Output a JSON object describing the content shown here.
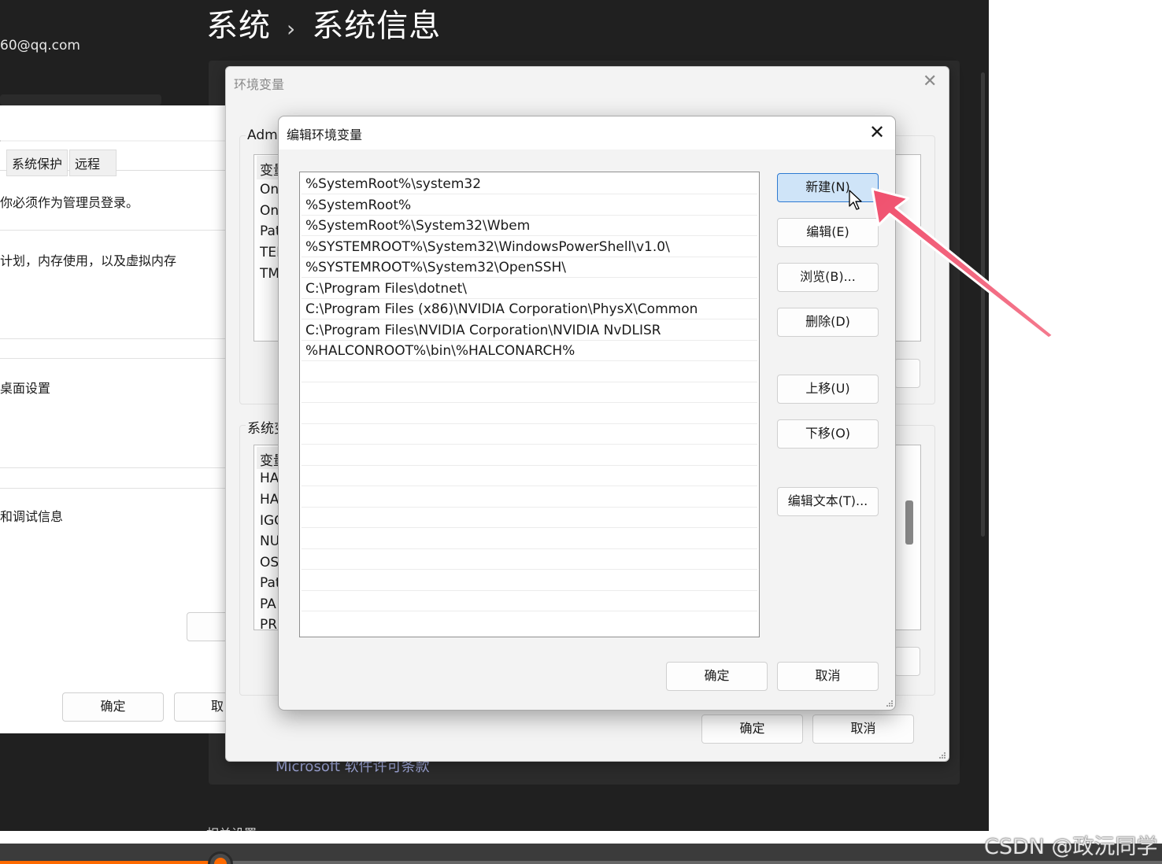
{
  "settings": {
    "breadcrumb_root": "系统",
    "breadcrumb_sep": "›",
    "breadcrumb_current": "系统信息",
    "account_email": "60@qq.com",
    "license_link": "Microsoft 软件许可条款",
    "related_settings": "相关设置"
  },
  "system_properties": {
    "tabs": [
      "系统保护",
      "远程"
    ],
    "admin_notice": "你必须作为管理员登录。",
    "performance_text": "计划，内存使用，以及虚拟内存",
    "profiles_text": "桌面设置",
    "startup_text": "和调试信息",
    "ok_label": "确定",
    "cancel_label": "取"
  },
  "env_vars": {
    "title": "环境变量",
    "user_group_label": "Adm",
    "user_list_header": "变量",
    "user_vars": [
      "On",
      "On",
      "Pat",
      "TEI",
      "TM"
    ],
    "system_group_label": "系统变",
    "system_list_header": "变量",
    "system_vars": [
      "HA",
      "HA",
      "IGC",
      "NU",
      "OS",
      "Pat",
      "PA",
      "PR"
    ],
    "ok_label": "确定",
    "cancel_label": "取消"
  },
  "edit_dialog": {
    "title": "编辑环境变量",
    "paths": [
      "%SystemRoot%\\system32",
      "%SystemRoot%",
      "%SystemRoot%\\System32\\Wbem",
      "%SYSTEMROOT%\\System32\\WindowsPowerShell\\v1.0\\",
      "%SYSTEMROOT%\\System32\\OpenSSH\\",
      "C:\\Program Files\\dotnet\\",
      "C:\\Program Files (x86)\\NVIDIA Corporation\\PhysX\\Common",
      "C:\\Program Files\\NVIDIA Corporation\\NVIDIA NvDLISR",
      "%HALCONROOT%\\bin\\%HALCONARCH%"
    ],
    "buttons": {
      "new": "新建(N)",
      "edit": "编辑(E)",
      "browse": "浏览(B)...",
      "delete": "删除(D)",
      "move_up": "上移(U)",
      "move_down": "下移(O)",
      "edit_text": "编辑文本(T)..."
    },
    "ok_label": "确定",
    "cancel_label": "取消"
  },
  "watermark": "CSDN @政沅同学",
  "video_progress": 0.19,
  "colors": {
    "settings_bg": "#202020",
    "accent_blue": "#2e7ad1",
    "primary_button_bg": "#cfe4f8",
    "annotation_arrow": "#f0506e",
    "video_progress": "#ff6a00"
  }
}
